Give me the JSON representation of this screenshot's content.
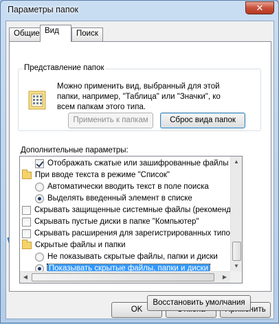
{
  "window": {
    "title": "Параметры папок",
    "close_glyph": "✕"
  },
  "tabs": [
    {
      "label": "Общие"
    },
    {
      "label": "Вид",
      "active": true
    },
    {
      "label": "Поиск"
    }
  ],
  "folder_views": {
    "legend": "Представление папок",
    "description": "Можно применить вид, выбранный для этой папки, например, \"Таблица\" или \"Значки\", ко всем папкам этого типа.",
    "apply_button": "Применить к папкам",
    "reset_button": "Сброс вида папок",
    "icon": "folder-view-icon"
  },
  "advanced": {
    "label": "Дополнительные параметры:",
    "items": [
      {
        "kind": "checkbox",
        "checked": true,
        "text": "Отображать сжатые или зашифрованные файлы NTFS"
      },
      {
        "kind": "folder",
        "text": "При вводе текста в режиме \"Список\""
      },
      {
        "kind": "radio",
        "checked": false,
        "text": "Автоматически вводить текст в поле поиска"
      },
      {
        "kind": "radio",
        "checked": true,
        "text": "Выделять введенный элемент в списке"
      },
      {
        "kind": "checkbox",
        "checked": false,
        "text": "Скрывать защищенные системные файлы (рекомендуется)"
      },
      {
        "kind": "checkbox",
        "checked": false,
        "text": "Скрывать пустые диски в папке \"Компьютер\""
      },
      {
        "kind": "checkbox",
        "checked": false,
        "text": "Скрывать расширения для зарегистрированных типов файлов"
      },
      {
        "kind": "folder",
        "text": "Скрытые файлы и папки"
      },
      {
        "kind": "radio",
        "checked": false,
        "text": "Не показывать скрытые файлы, папки и диски"
      },
      {
        "kind": "radio",
        "checked": true,
        "selected": true,
        "text": "Показывать скрытые файлы, папки и диски"
      }
    ]
  },
  "restore_button": "Восстановить умолчания",
  "footer": {
    "ok": "OK",
    "cancel": "Отмена",
    "apply": "Применить"
  },
  "colors": {
    "selection": "#3399ff",
    "annotation_arrow": "#2f8fe6"
  }
}
